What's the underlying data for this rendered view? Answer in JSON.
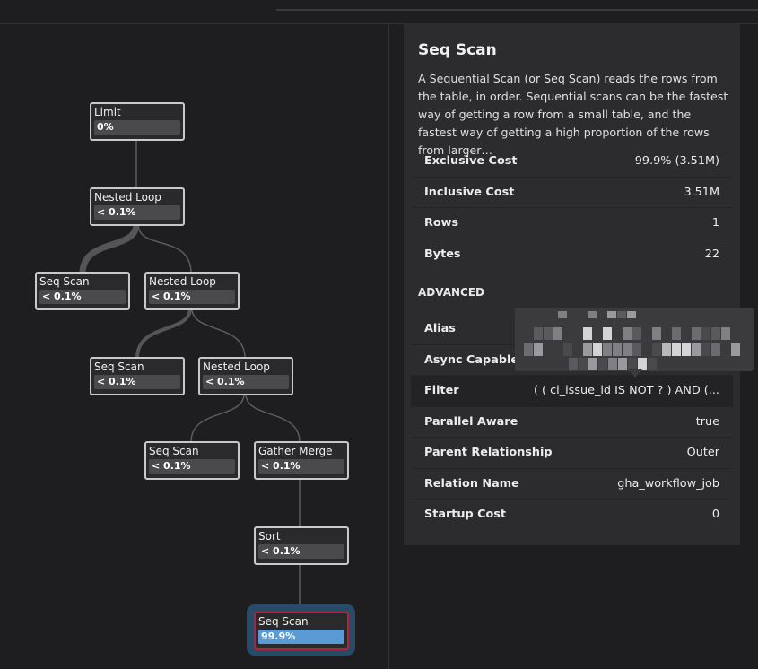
{
  "graph": {
    "nodes": {
      "limit": {
        "label": "Limit",
        "pct": "0%",
        "fill": 0
      },
      "nested_loop_1": {
        "label": "Nested Loop",
        "pct": "< 0.1%",
        "fill": 0
      },
      "seq_scan_1": {
        "label": "Seq Scan",
        "pct": "< 0.1%",
        "fill": 0
      },
      "nested_loop_2": {
        "label": "Nested Loop",
        "pct": "< 0.1%",
        "fill": 0
      },
      "seq_scan_2": {
        "label": "Seq Scan",
        "pct": "< 0.1%",
        "fill": 0
      },
      "nested_loop_3": {
        "label": "Nested Loop",
        "pct": "< 0.1%",
        "fill": 0
      },
      "seq_scan_3": {
        "label": "Seq Scan",
        "pct": "< 0.1%",
        "fill": 0
      },
      "gather_merge": {
        "label": "Gather Merge",
        "pct": "< 0.1%",
        "fill": 0
      },
      "sort": {
        "label": "Sort",
        "pct": "< 0.1%",
        "fill": 0
      },
      "seq_scan_4": {
        "label": "Seq Scan",
        "pct": "99.9%",
        "fill": 0.999
      }
    }
  },
  "panel": {
    "title": "Seq Scan",
    "description": "A Sequential Scan (or Seq Scan) reads the rows from the table, in order. Sequential scans can be the fastest way of getting a row from a small table, and the fastest way of getting a high proportion of the rows from larger…",
    "stats": [
      {
        "key": "Exclusive Cost",
        "value": "99.9% (3.51M)"
      },
      {
        "key": "Inclusive Cost",
        "value": "3.51M"
      },
      {
        "key": "Rows",
        "value": "1"
      },
      {
        "key": "Bytes",
        "value": "22"
      }
    ],
    "advanced_heading": "ADVANCED",
    "advanced": [
      {
        "key": "Alias",
        "value": ""
      },
      {
        "key": "Async Capable",
        "value": ""
      },
      {
        "key": "Filter",
        "value": "( ( ci_issue_id IS NOT ? ) AND (..."
      },
      {
        "key": "Parallel Aware",
        "value": "true"
      },
      {
        "key": "Parent Relationship",
        "value": "Outer"
      },
      {
        "key": "Relation Name",
        "value": "gha_workflow_job"
      },
      {
        "key": "Startup Cost",
        "value": "0"
      }
    ]
  },
  "colors": {
    "accent": "#5b9bd5",
    "selected_border": "#b3243a",
    "halo": "#284b68"
  }
}
